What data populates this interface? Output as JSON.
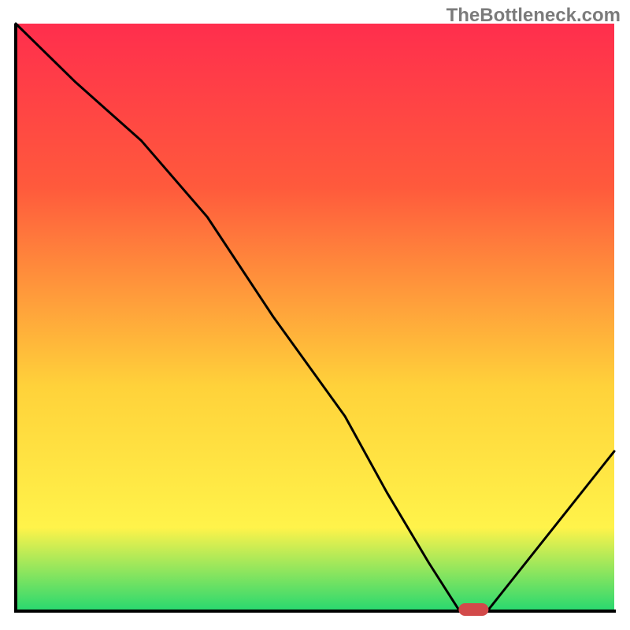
{
  "watermark": "TheBottleneck.com",
  "colors": {
    "grad_top": "#ff2e4d",
    "grad_mid1": "#ff5a3c",
    "grad_mid2": "#ffd23a",
    "grad_mid3": "#fff34a",
    "grad_bot": "#2bd96f",
    "axis": "#000000",
    "curve": "#000000",
    "marker": "#d24a4a"
  },
  "chart_data": {
    "type": "line",
    "title": "",
    "xlabel": "",
    "ylabel": "",
    "xlim": [
      0,
      100
    ],
    "ylim": [
      0,
      100
    ],
    "x": [
      0,
      10,
      21,
      32,
      43,
      55,
      62,
      69,
      74,
      79,
      100
    ],
    "values": [
      100,
      90,
      80,
      67,
      50,
      33,
      20,
      8,
      0,
      0,
      27
    ],
    "marker": {
      "x_range": [
        74,
        79
      ],
      "y": 0
    },
    "gradient_direction": "vertical_top_red_bottom_green"
  }
}
